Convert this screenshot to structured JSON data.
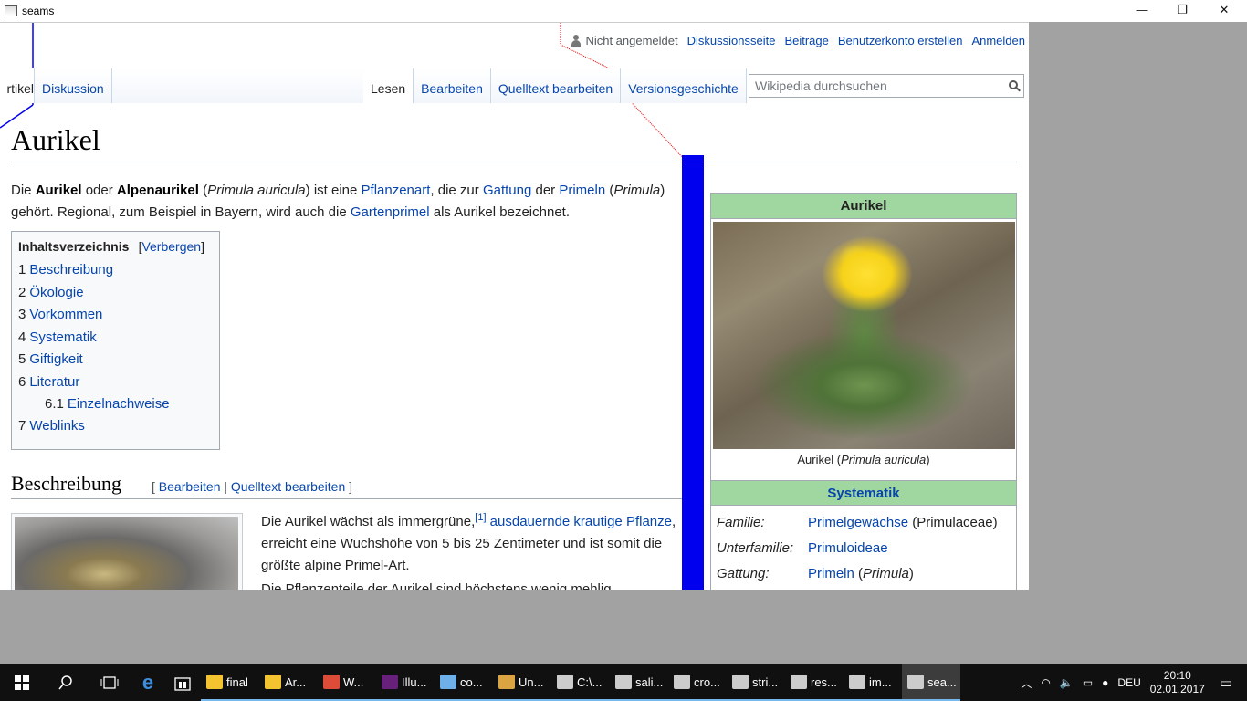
{
  "window": {
    "title": "seams",
    "minimize": "—",
    "maximize": "❐",
    "close": "✕"
  },
  "personal": {
    "not_logged_in": "Nicht angemeldet",
    "discussion": "Diskussionsseite",
    "contributions": "Beiträge",
    "create_account": "Benutzerkonto erstellen",
    "login": "Anmelden"
  },
  "tabs": {
    "article": "rtikel",
    "discussion": "Diskussion",
    "read": "Lesen",
    "edit": "Bearbeiten",
    "edit_source": "Quelltext bearbeiten",
    "history": "Versionsgeschichte"
  },
  "search": {
    "placeholder": "Wikipedia durchsuchen"
  },
  "article": {
    "title": "Aurikel",
    "intro": {
      "t1": "Die ",
      "b1": "Aurikel",
      "t2": " oder ",
      "b2": "Alpenaurikel",
      "t3": " (",
      "i1": "Primula auricula",
      "t4": ") ist eine ",
      "l1": "Pflanzenart",
      "t5": ", die zur ",
      "l2": "Gattung",
      "t6": " der ",
      "l3": "Primeln",
      "t7": " (",
      "i2": "Primula",
      "t8": ") gehört. Regional, zum Beispiel in Bayern, wird auch die ",
      "l4": "Gartenprimel",
      "t9": " als Aurikel bezeichnet."
    },
    "toc": {
      "title": "Inhaltsverzeichnis",
      "toggle_open": "[",
      "toggle": "Verbergen",
      "toggle_close": "]",
      "items": [
        {
          "num": "1",
          "label": "Beschreibung"
        },
        {
          "num": "2",
          "label": "Ökologie"
        },
        {
          "num": "3",
          "label": "Vorkommen"
        },
        {
          "num": "4",
          "label": "Systematik"
        },
        {
          "num": "5",
          "label": "Giftigkeit"
        },
        {
          "num": "6",
          "label": "Literatur"
        },
        {
          "num": "6.1",
          "label": "Einzelnachweise"
        },
        {
          "num": "7",
          "label": "Weblinks"
        }
      ]
    },
    "section1": {
      "heading": "Beschreibung",
      "edit_open": "[ ",
      "edit": "Bearbeiten",
      "sep": " | ",
      "edit_source": "Quelltext bearbeiten",
      "edit_close": " ]",
      "p1_a": "Die Aurikel wächst als immergrüne,",
      "ref": "[1]",
      "p1_link": "ausdauernde krautige Pflanze",
      "p1_b": ", erreicht eine Wuchshöhe von 5 bis 25 Zentimeter und ist somit die größte alpine Primel-Art.",
      "p2": "Die Pflanzenteile der Aurikel sind höchstens wenig mehlig"
    }
  },
  "infobox": {
    "title": "Aurikel",
    "caption_a": "Aurikel (",
    "caption_i": "Primula auricula",
    "caption_b": ")",
    "systematik": "Systematik",
    "rows": [
      {
        "key": "Familie:",
        "link": "Primelgewächse",
        "extra": " (Primulaceae)"
      },
      {
        "key": "Unterfamilie:",
        "link": "Primuloideae",
        "extra": ""
      },
      {
        "key": "Gattung:",
        "link": "Primeln",
        "extra_a": " (",
        "extra_i": "Primula",
        "extra_b": ")"
      }
    ]
  },
  "taskbar": {
    "tasks": [
      {
        "label": "final",
        "icon": "folder-icon",
        "color": "#f4c430"
      },
      {
        "label": "Ar...",
        "icon": "folder-icon",
        "color": "#f4c430"
      },
      {
        "label": "W...",
        "icon": "chrome-icon",
        "color": "#dd4b39"
      },
      {
        "label": "Illu...",
        "icon": "visual-studio-icon",
        "color": "#68217a"
      },
      {
        "label": "co...",
        "icon": "notepad-icon",
        "color": "#6fb0e8"
      },
      {
        "label": "Un...",
        "icon": "paint-icon",
        "color": "#d9a441"
      },
      {
        "label": "C:\\...",
        "icon": "console-icon",
        "color": "#cccccc"
      },
      {
        "label": "sali...",
        "icon": "window-icon",
        "color": "#cccccc"
      },
      {
        "label": "cro...",
        "icon": "window-icon",
        "color": "#cccccc"
      },
      {
        "label": "stri...",
        "icon": "window-icon",
        "color": "#cccccc"
      },
      {
        "label": "res...",
        "icon": "window-icon",
        "color": "#cccccc"
      },
      {
        "label": "im...",
        "icon": "window-icon",
        "color": "#cccccc"
      },
      {
        "label": "sea...",
        "icon": "window-icon",
        "color": "#cccccc"
      }
    ],
    "lang": "DEU",
    "time": "20:10",
    "date": "02.01.2017"
  }
}
